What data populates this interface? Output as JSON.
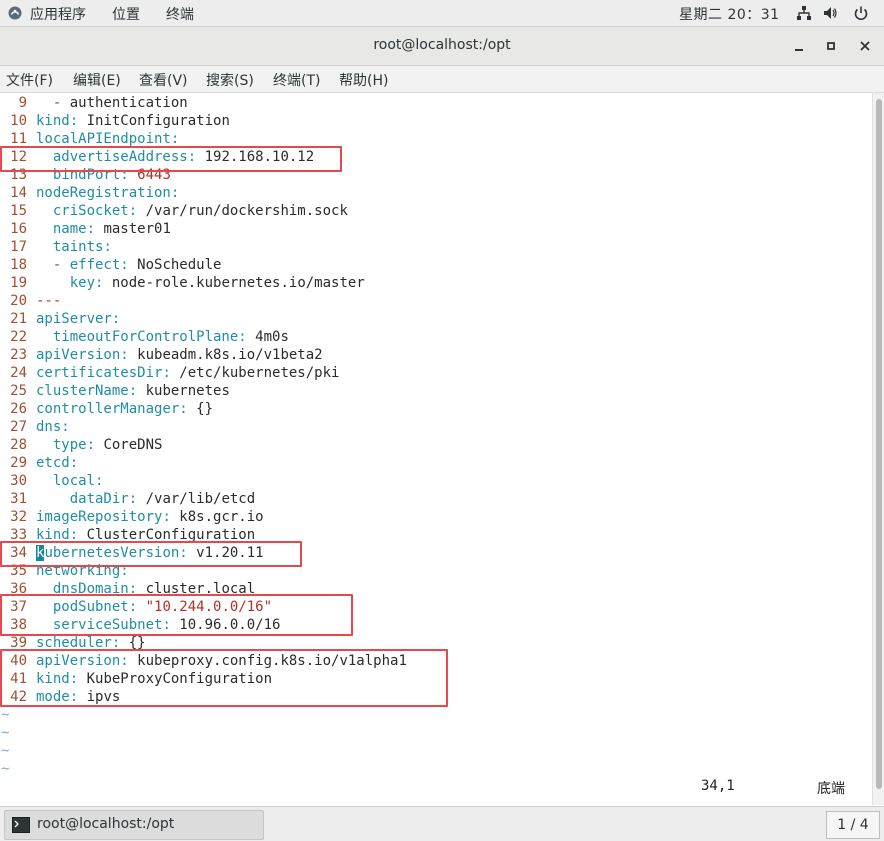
{
  "topbar": {
    "apps_label": "应用程序",
    "places_label": "位置",
    "terminal_label": "终端",
    "clock": "星期二 20：31"
  },
  "window": {
    "title": "root@localhost:/opt"
  },
  "menubar": {
    "items": [
      "文件(F)",
      "编辑(E)",
      "查看(V)",
      "搜索(S)",
      "终端(T)",
      "帮助(H)"
    ]
  },
  "editor": {
    "lines": [
      {
        "n": "9",
        "parts": [
          [
            "dash",
            "  - "
          ],
          [
            "v",
            "authentication"
          ]
        ]
      },
      {
        "n": "10",
        "parts": [
          [
            "k",
            "kind"
          ],
          [
            "p",
            ":"
          ],
          [
            "v",
            " InitConfiguration"
          ]
        ]
      },
      {
        "n": "11",
        "parts": [
          [
            "k",
            "localAPIEndpoint"
          ],
          [
            "p",
            ":"
          ]
        ]
      },
      {
        "n": "12",
        "parts": [
          [
            "k",
            "  advertiseAddress"
          ],
          [
            "p",
            ":"
          ],
          [
            "v",
            " 192.168.10.12"
          ]
        ]
      },
      {
        "n": "13",
        "parts": [
          [
            "k",
            "  bindPort"
          ],
          [
            "p",
            ":"
          ],
          [
            "s",
            " 6443"
          ]
        ]
      },
      {
        "n": "14",
        "parts": [
          [
            "k",
            "nodeRegistration"
          ],
          [
            "p",
            ":"
          ]
        ]
      },
      {
        "n": "15",
        "parts": [
          [
            "k",
            "  criSocket"
          ],
          [
            "p",
            ":"
          ],
          [
            "v",
            " /var/run/dockershim.sock"
          ]
        ]
      },
      {
        "n": "16",
        "parts": [
          [
            "k",
            "  name"
          ],
          [
            "p",
            ":"
          ],
          [
            "v",
            " master01"
          ]
        ]
      },
      {
        "n": "17",
        "parts": [
          [
            "k",
            "  taints"
          ],
          [
            "p",
            ":"
          ]
        ]
      },
      {
        "n": "18",
        "parts": [
          [
            "dash",
            "  - "
          ],
          [
            "k",
            "effect"
          ],
          [
            "p",
            ":"
          ],
          [
            "v",
            " NoSchedule"
          ]
        ]
      },
      {
        "n": "19",
        "parts": [
          [
            "k",
            "    key"
          ],
          [
            "p",
            ":"
          ],
          [
            "v",
            " node-role.kubernetes.io/master"
          ]
        ]
      },
      {
        "n": "20",
        "parts": [
          [
            "dash",
            "---"
          ]
        ]
      },
      {
        "n": "21",
        "parts": [
          [
            "k",
            "apiServer"
          ],
          [
            "p",
            ":"
          ]
        ]
      },
      {
        "n": "22",
        "parts": [
          [
            "k",
            "  timeoutForControlPlane"
          ],
          [
            "p",
            ":"
          ],
          [
            "v",
            " 4m0s"
          ]
        ]
      },
      {
        "n": "23",
        "parts": [
          [
            "k",
            "apiVersion"
          ],
          [
            "p",
            ":"
          ],
          [
            "v",
            " kubeadm.k8s.io/v1beta2"
          ]
        ]
      },
      {
        "n": "24",
        "parts": [
          [
            "k",
            "certificatesDir"
          ],
          [
            "p",
            ":"
          ],
          [
            "v",
            " /etc/kubernetes/pki"
          ]
        ]
      },
      {
        "n": "25",
        "parts": [
          [
            "k",
            "clusterName"
          ],
          [
            "p",
            ":"
          ],
          [
            "v",
            " kubernetes"
          ]
        ]
      },
      {
        "n": "26",
        "parts": [
          [
            "k",
            "controllerManager"
          ],
          [
            "p",
            ":"
          ],
          [
            "v",
            " {}"
          ]
        ]
      },
      {
        "n": "27",
        "parts": [
          [
            "k",
            "dns"
          ],
          [
            "p",
            ":"
          ]
        ]
      },
      {
        "n": "28",
        "parts": [
          [
            "k",
            "  type"
          ],
          [
            "p",
            ":"
          ],
          [
            "v",
            " CoreDNS"
          ]
        ]
      },
      {
        "n": "29",
        "parts": [
          [
            "k",
            "etcd"
          ],
          [
            "p",
            ":"
          ]
        ]
      },
      {
        "n": "30",
        "parts": [
          [
            "k",
            "  local"
          ],
          [
            "p",
            ":"
          ]
        ]
      },
      {
        "n": "31",
        "parts": [
          [
            "k",
            "    dataDir"
          ],
          [
            "p",
            ":"
          ],
          [
            "v",
            " /var/lib/etcd"
          ]
        ]
      },
      {
        "n": "32",
        "parts": [
          [
            "k",
            "imageRepository"
          ],
          [
            "p",
            ":"
          ],
          [
            "v",
            " k8s.gcr.io"
          ]
        ]
      },
      {
        "n": "33",
        "parts": [
          [
            "k",
            "kind"
          ],
          [
            "p",
            ":"
          ],
          [
            "v",
            " ClusterConfiguration"
          ]
        ]
      },
      {
        "n": "34",
        "parts": [
          [
            "cursor",
            "k"
          ],
          [
            "k",
            "ubernetesVersion"
          ],
          [
            "p",
            ":"
          ],
          [
            "v",
            " v1.20.11"
          ]
        ]
      },
      {
        "n": "35",
        "parts": [
          [
            "k",
            "networking"
          ],
          [
            "p",
            ":"
          ]
        ]
      },
      {
        "n": "36",
        "parts": [
          [
            "k",
            "  dnsDomain"
          ],
          [
            "p",
            ":"
          ],
          [
            "v",
            " cluster.local"
          ]
        ]
      },
      {
        "n": "37",
        "parts": [
          [
            "k",
            "  podSubnet"
          ],
          [
            "p",
            ":"
          ],
          [
            "s",
            " \"10.244.0.0/16\""
          ]
        ]
      },
      {
        "n": "38",
        "parts": [
          [
            "k",
            "  serviceSubnet"
          ],
          [
            "p",
            ":"
          ],
          [
            "v",
            " 10.96.0.0/16"
          ]
        ]
      },
      {
        "n": "39",
        "parts": [
          [
            "k",
            "scheduler"
          ],
          [
            "p",
            ":"
          ],
          [
            "v",
            " {}"
          ]
        ]
      },
      {
        "n": "40",
        "parts": [
          [
            "k",
            "apiVersion"
          ],
          [
            "p",
            ":"
          ],
          [
            "v",
            " kubeproxy.config.k8s.io/v1alpha1"
          ]
        ]
      },
      {
        "n": "41",
        "parts": [
          [
            "k",
            "kind"
          ],
          [
            "p",
            ":"
          ],
          [
            "v",
            " KubeProxyConfiguration"
          ]
        ]
      },
      {
        "n": "42",
        "parts": [
          [
            "k",
            "mode"
          ],
          [
            "p",
            ":"
          ],
          [
            "v",
            " ipvs"
          ]
        ]
      }
    ],
    "tildes": [
      "~",
      "~",
      "~",
      "~"
    ],
    "cursor_position": "34,1",
    "scroll_position": "底端"
  },
  "taskbar": {
    "window_label": "root@localhost:/opt",
    "workspace": "1 / 4"
  },
  "colors": {
    "highlight_box": "#e5484d",
    "key": "#1f8ea3",
    "string": "#b3302a",
    "line_number": "#a05030"
  }
}
